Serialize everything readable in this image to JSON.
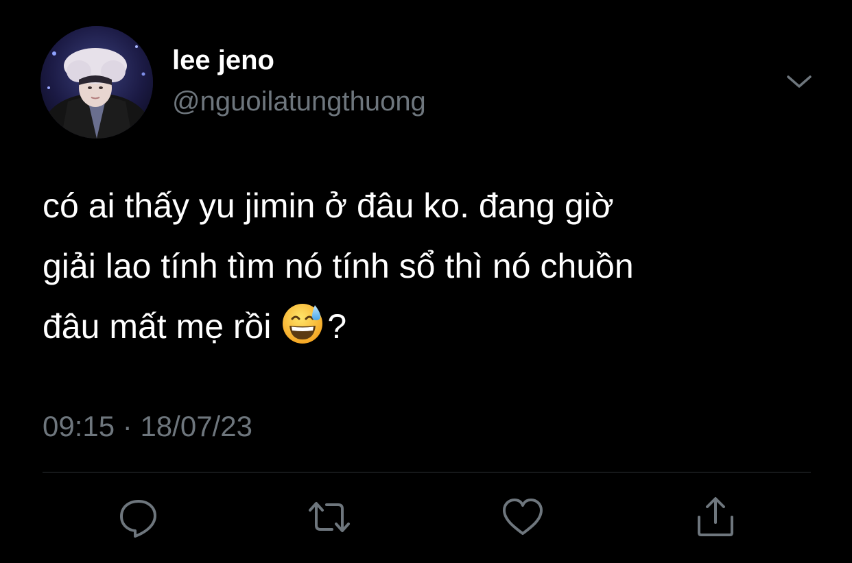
{
  "user": {
    "display_name": "lee jeno",
    "handle": "@nguoilatungthuong",
    "avatar_icon": "profile-photo"
  },
  "tweet": {
    "lines": [
      "có ai thấy yu jimin ở đâu ko. đang giờ",
      "giải lao tính tìm nó tính sổ thì nó chuồn",
      "đâu mất mẹ rồi"
    ],
    "emoji": "grinning-face-with-sweat",
    "trailing": "?",
    "time": "09:15",
    "separator": "·",
    "date": "18/07/23"
  },
  "actions": {
    "reply_icon": "reply-icon",
    "retweet_icon": "retweet-icon",
    "like_icon": "heart-icon",
    "share_icon": "share-icon"
  },
  "colors": {
    "background": "#000000",
    "text_primary": "#ffffff",
    "text_secondary": "#6e767d",
    "divider": "#2f3336",
    "icon": "#6e767d"
  }
}
